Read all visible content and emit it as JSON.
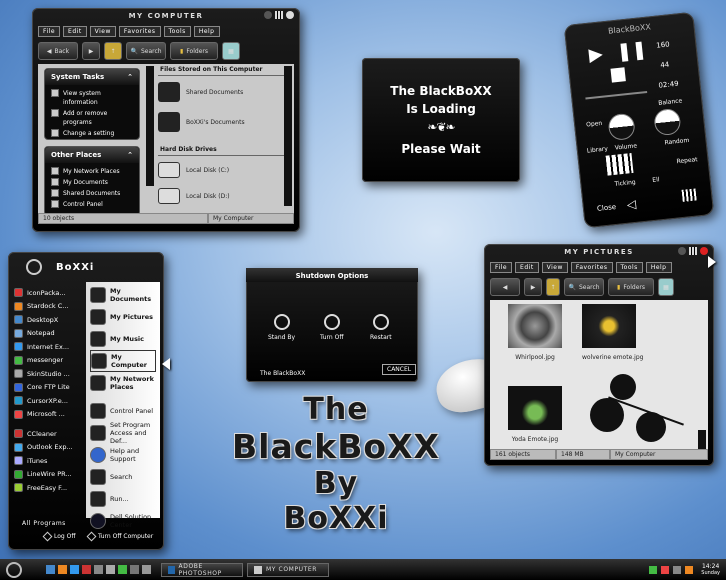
{
  "colors": {
    "accent": "#000000",
    "desktop": "#5d8fcd",
    "pane": "#c9c9c9"
  },
  "my_computer": {
    "title": "My Computer",
    "menu": [
      "File",
      "Edit",
      "View",
      "Favorites",
      "Tools",
      "Help"
    ],
    "toolbar": {
      "back": "Back",
      "search": "Search",
      "folders": "Folders"
    },
    "system_tasks": {
      "title": "System Tasks",
      "items": [
        "View system information",
        "Add or remove programs",
        "Change a setting"
      ]
    },
    "other_places": {
      "title": "Other Places",
      "items": [
        "My Network Places",
        "My Documents",
        "Shared Documents",
        "Control Panel"
      ]
    },
    "section_files": "Files Stored on This Computer",
    "files": [
      "Shared Documents",
      "BoXXi's Documents"
    ],
    "section_drives": "Hard Disk Drives",
    "drives": [
      "Local Disk (C:)",
      "Local Disk (D:)"
    ],
    "status_objects": "10 objects",
    "status_location": "My Computer"
  },
  "loading": {
    "line1": "The BlackBoXX",
    "line2": "Is Loading",
    "line3": "Please Wait"
  },
  "player": {
    "title": "BlackBoXX",
    "counts": [
      "160",
      "44",
      "02:49"
    ],
    "labels": [
      "Open",
      "Balance",
      "Library",
      "Volume",
      "Random",
      "Ticking",
      "Ell",
      "Repeat",
      "Close"
    ]
  },
  "start_menu": {
    "user": "BoXXi",
    "left_items": [
      "IconPacka...",
      "Stardock C...",
      "DesktopX",
      "Notepad",
      "Internet Ex...",
      "messenger",
      "SkinStudio ...",
      "Core FTP Lite",
      "CursorXP.e...",
      "Microsoft ...",
      "CCleaner",
      "Outlook Exp...",
      "iTunes",
      "LineWire PR...",
      "FreeEasy F..."
    ],
    "right_items": [
      "My Documents",
      "My Pictures",
      "My Music",
      "My Computer",
      "My Network Places"
    ],
    "right_items2": [
      "Control Panel",
      "Set Program Access and Def...",
      "Help and Support",
      "Search",
      "Run...",
      "Dell Solution Center"
    ],
    "all_programs": "All Programs",
    "log_off": "Log Off",
    "turn_off": "Turn Off Computer"
  },
  "shutdown": {
    "title": "Shutdown Options",
    "options": [
      "Stand By",
      "Turn Off",
      "Restart"
    ],
    "brand": "The BlackBoXX",
    "cancel": "Cancel"
  },
  "my_pictures": {
    "title": "My Pictures",
    "menu": [
      "File",
      "Edit",
      "View",
      "Favorites",
      "Tools",
      "Help"
    ],
    "toolbar": {
      "search": "Search",
      "folders": "Folders"
    },
    "images": [
      "Whirlpool.jpg",
      "wolverine emote.jpg",
      "Yoda Emote.jpg"
    ],
    "status_objects": "161 objects",
    "status_size": "148 MB",
    "status_location": "My Computer"
  },
  "headline": {
    "l1": "The",
    "l2": "BlackBoXX",
    "l3": "By",
    "l4": "BoXXi"
  },
  "taskbar": {
    "tasks": [
      "Adobe Photoshop",
      "My Computer"
    ],
    "time": "14:24",
    "day": "Sunday"
  }
}
